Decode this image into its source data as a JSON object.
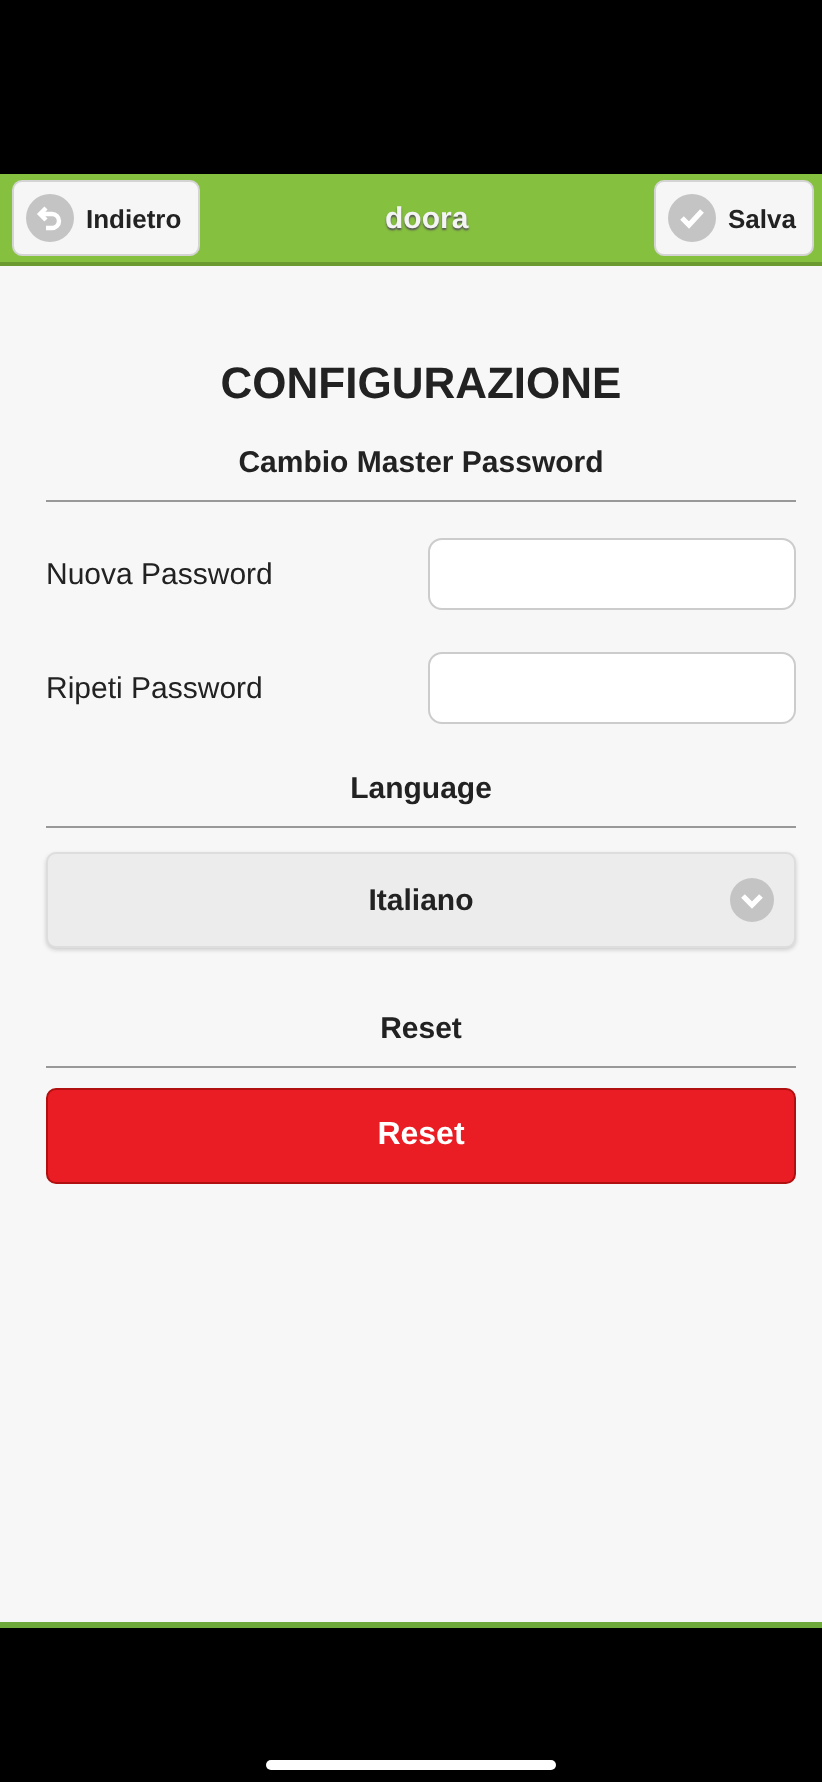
{
  "header": {
    "back_button": "Indietro",
    "title": "doora",
    "save_button": "Salva"
  },
  "title": "CONFIGURAZIONE",
  "password_section": {
    "heading": "Cambio Master Password",
    "fields": [
      {
        "label": "Nuova Password"
      },
      {
        "label": "Ripeti Password"
      }
    ]
  },
  "language_section": {
    "heading": "Language",
    "select": {
      "value": "Italiano"
    }
  },
  "reset_section": {
    "heading": "Reset",
    "button": "Reset"
  }
}
